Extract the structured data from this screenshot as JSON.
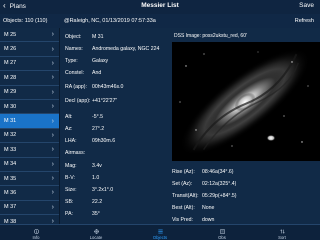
{
  "header": {
    "back_label": "Plans",
    "title": "Messier List",
    "save_label": "Save"
  },
  "subheader": {
    "objects": "Objects: 110 (110)",
    "location": "@Raleigh, NC, 01/13/2019 07:57:33a",
    "refresh_label": "Refresh"
  },
  "sidebar": {
    "items": [
      {
        "label": "M 25",
        "selected": false
      },
      {
        "label": "M 26",
        "selected": false
      },
      {
        "label": "M 27",
        "selected": false
      },
      {
        "label": "M 28",
        "selected": false
      },
      {
        "label": "M 29",
        "selected": false
      },
      {
        "label": "M 30",
        "selected": false
      },
      {
        "label": "M 31",
        "selected": true
      },
      {
        "label": "M 32",
        "selected": false
      },
      {
        "label": "M 33",
        "selected": false
      },
      {
        "label": "M 34",
        "selected": false
      },
      {
        "label": "M 35",
        "selected": false
      },
      {
        "label": "M 36",
        "selected": false
      },
      {
        "label": "M 37",
        "selected": false
      },
      {
        "label": "M 38",
        "selected": false
      }
    ]
  },
  "detail": {
    "dss_caption": "DSS Image: poss2ukstu_red, 60'",
    "left_fields": [
      {
        "key": "Object:",
        "value": "M 31"
      },
      {
        "key": "Names:",
        "value": "Andromeda galaxy, NGC 224"
      },
      {
        "key": "Type:",
        "value": "Galaxy"
      },
      {
        "key": "Constel:",
        "value": "And"
      },
      {
        "key": "RA (app):",
        "value": "00h43m46s.0"
      },
      {
        "key": "Decl (app):",
        "value": "+41°22'27\""
      },
      {
        "key": "Alt:",
        "value": "-5°.5"
      },
      {
        "key": "Az:",
        "value": "27°.2"
      },
      {
        "key": "LHA:",
        "value": "09h30m.6"
      },
      {
        "key": "Airmass:",
        "value": ""
      },
      {
        "key": "Mag:",
        "value": "3.4v"
      },
      {
        "key": "B-V:",
        "value": "1.0"
      },
      {
        "key": "Size:",
        "value": "3°.2x1°.0"
      },
      {
        "key": "SB:",
        "value": "22.2"
      },
      {
        "key": "PA:",
        "value": "35°"
      }
    ],
    "right_fields": [
      {
        "key": "Rise (Az):",
        "value": "08:46a(34°.6)"
      },
      {
        "key": "Set (Az):",
        "value": "02:12a(325°.4)"
      },
      {
        "key": "Transit(Alt):",
        "value": "05:29p(+84°.5)"
      },
      {
        "key": "Best (Alt):",
        "value": "None"
      },
      {
        "key": "Vis Pred:",
        "value": "down"
      }
    ]
  },
  "tabbar": {
    "tabs": [
      {
        "label": "Info",
        "icon": "info-icon",
        "active": false
      },
      {
        "label": "Locate",
        "icon": "locate-icon",
        "active": false
      },
      {
        "label": "Objects",
        "icon": "objects-icon",
        "active": true
      },
      {
        "label": "Obs",
        "icon": "observations-icon",
        "active": false
      },
      {
        "label": "Sort",
        "icon": "sort-icon",
        "active": false
      }
    ]
  }
}
